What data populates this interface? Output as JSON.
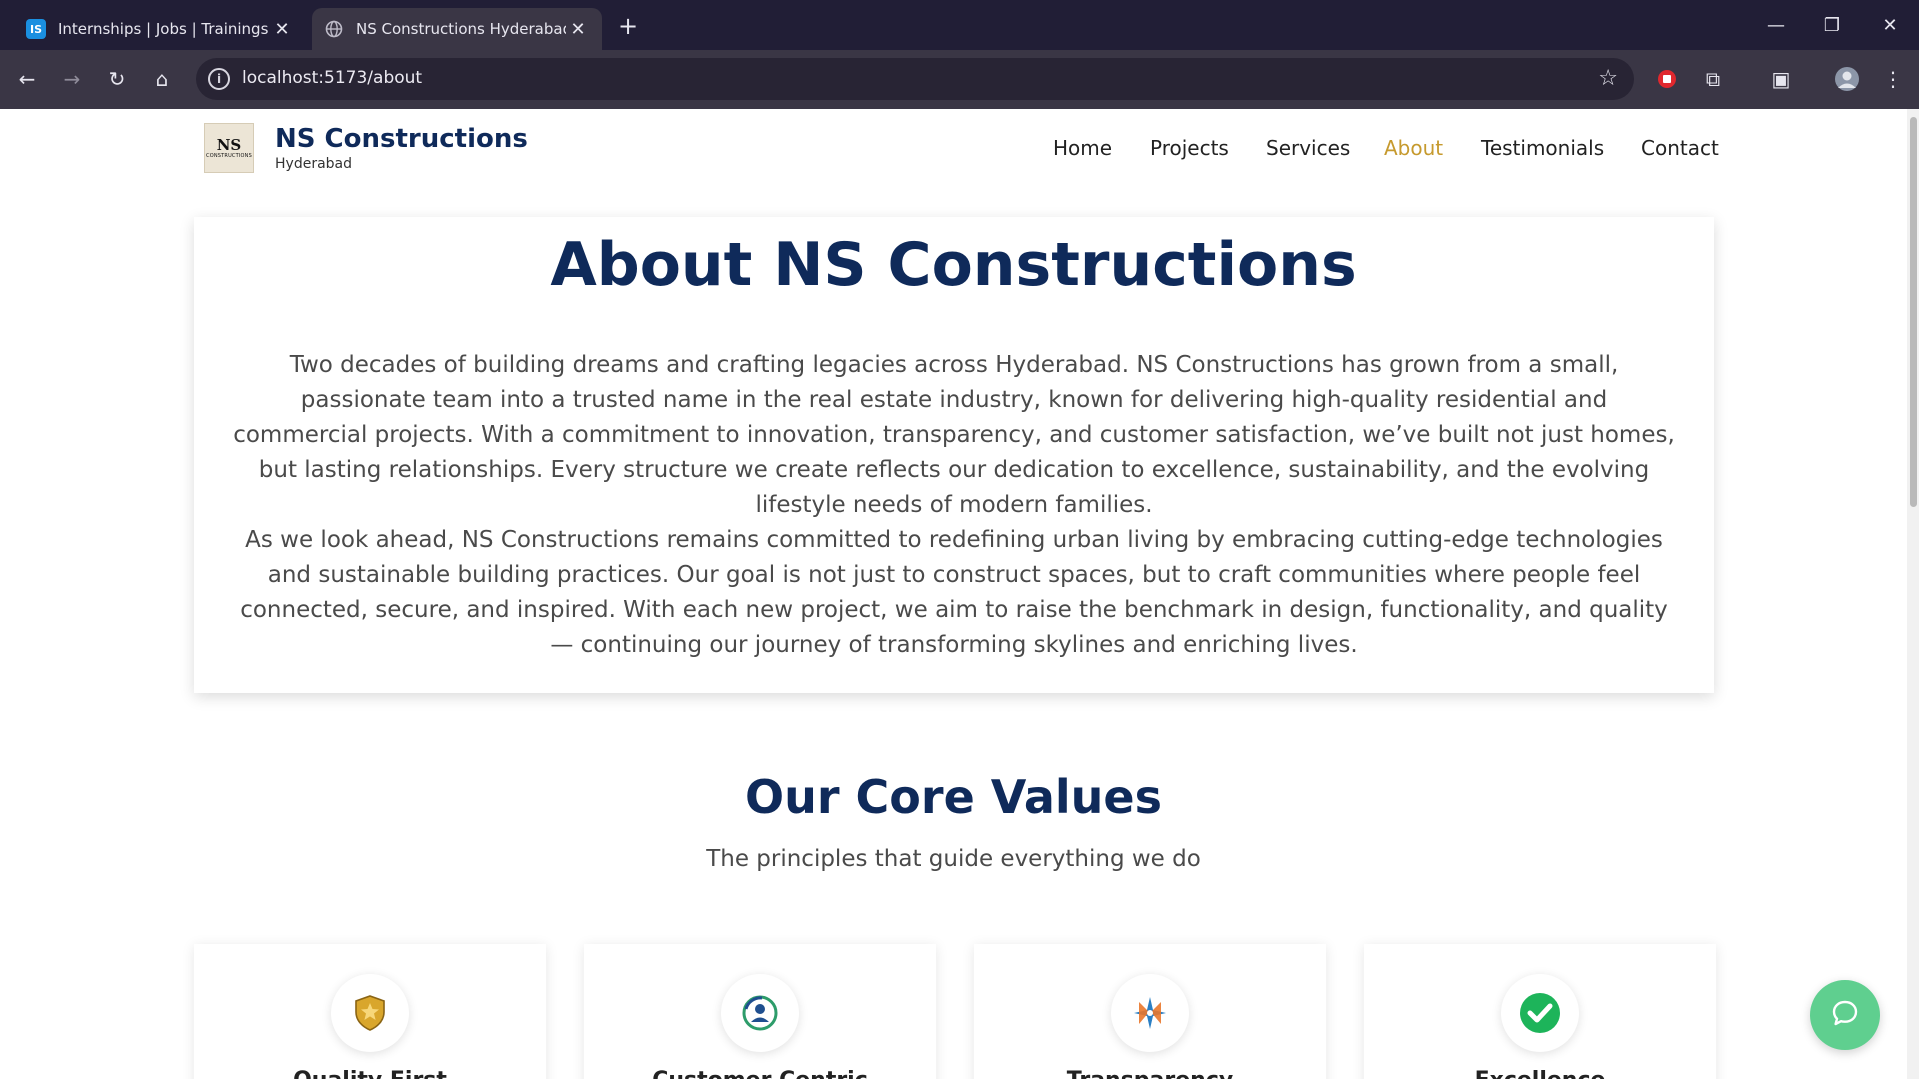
{
  "browser": {
    "tabs": [
      {
        "title": "Internships | Jobs | Trainings & I",
        "favicon": "IS",
        "active": false
      },
      {
        "title": "NS Constructions Hyderabad - I",
        "favicon": "globe-icon",
        "active": true
      }
    ],
    "url": "localhost:5173/about"
  },
  "site": {
    "brand_name": "NS Constructions",
    "brand_city": "Hyderabad",
    "logo_text": "NS",
    "logo_subtext": "CONSTRUCTIONS",
    "nav": [
      "Home",
      "Projects",
      "Services",
      "About",
      "Testimonials",
      "Contact"
    ],
    "active_nav": "About"
  },
  "about": {
    "title": "About NS Constructions",
    "paragraph1": "Two decades of building dreams and crafting legacies across Hyderabad. NS Constructions has grown from a small, passionate team into a trusted name in the real estate industry, known for delivering high-quality residential and commercial projects. With a commitment to innovation, transparency, and customer satisfaction, we’ve built not just homes, but lasting relationships. Every structure we create reflects our dedication to excellence, sustainability, and the evolving lifestyle needs of modern families.",
    "paragraph2": "As we look ahead, NS Constructions remains committed to redefining urban living by embracing cutting-edge technologies and sustainable building practices. Our goal is not just to construct spaces, but to craft communities where people feel connected, secure, and inspired. With each new project, we aim to raise the benchmark in design, functionality, and quality — continuing our journey of transforming skylines and enriching lives."
  },
  "values": {
    "title": "Our Core Values",
    "subtitle": "The principles that guide everything we do",
    "cards": [
      {
        "icon": "shield-icon",
        "name": "Quality First"
      },
      {
        "icon": "customer-icon",
        "name": "Customer Centric"
      },
      {
        "icon": "innovation-icon",
        "name": "Transparency"
      },
      {
        "icon": "check-icon",
        "name": "Excellence"
      }
    ]
  },
  "colors": {
    "brand_navy": "#0f2a5a",
    "active_gold": "#c69a2e",
    "chat_green": "#5fcf8f"
  }
}
